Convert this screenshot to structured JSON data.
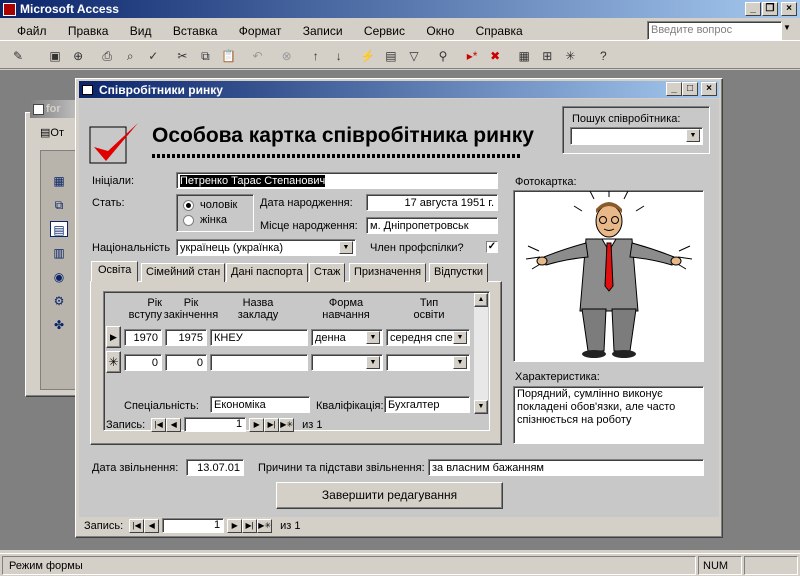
{
  "app": {
    "title": "Microsoft Access"
  },
  "menu": {
    "items": [
      "Файл",
      "Правка",
      "Вид",
      "Вставка",
      "Формат",
      "Записи",
      "Сервис",
      "Окно",
      "Справка"
    ],
    "help_placeholder": "Введите вопрос"
  },
  "bg_window": {
    "title": "for",
    "tab_label": "От"
  },
  "form": {
    "window_title": "Співробітники ринку",
    "heading": "Особова картка співробітника ринку",
    "search": {
      "label": "Пошук співробітника:",
      "value": ""
    },
    "initials": {
      "label": "Ініціали:",
      "value": "Петренко Тарас Степанович"
    },
    "gender": {
      "label": "Стать:",
      "options": [
        "чоловік",
        "жінка"
      ],
      "selected": "чоловік"
    },
    "birth_date": {
      "label": "Дата народження:",
      "value": "17 августа 1951 г."
    },
    "birth_place": {
      "label": "Місце народження:",
      "value": "м. Дніпропетровськ"
    },
    "nationality": {
      "label": "Національність",
      "value": "українець (українка)"
    },
    "union": {
      "label": "Член профспілки?",
      "checked": true
    },
    "photo": {
      "label": "Фотокартка:"
    },
    "characteristic": {
      "label": "Характеристика:",
      "value": "Порядний, сумлінно виконує покладені обов'язки, але часто спізнюється на роботу"
    },
    "tabs": [
      "Освіта",
      "Сімейний стан",
      "Дані паспорта",
      "Стаж",
      "Призначення",
      "Відпустки"
    ],
    "education": {
      "headers": {
        "start": [
          "Рік",
          "вступу"
        ],
        "end": [
          "Рік",
          "закінчення"
        ],
        "school": [
          "Назва",
          "закладу"
        ],
        "form": [
          "Форма",
          "навчання"
        ],
        "type": [
          "Тип",
          "освіти"
        ]
      },
      "rows": [
        {
          "start": "1970",
          "end": "1975",
          "school": "КНЕУ",
          "form": "денна",
          "type": "середня спе"
        },
        {
          "start": "0",
          "end": "0",
          "school": "",
          "form": "",
          "type": ""
        }
      ],
      "specialty": {
        "label": "Спеціальність:",
        "value": "Економіка"
      },
      "qualification": {
        "label": "Кваліфікація:",
        "value": "Бухгалтер"
      },
      "nav": {
        "label": "Запись:",
        "current": "1",
        "of": "из  1"
      }
    },
    "dismissal_date": {
      "label": "Дата звільнення:",
      "value": "13.07.01"
    },
    "dismissal_reason": {
      "label": "Причини та підстави звільнення:",
      "value": "за власним бажанням"
    },
    "finish_button": "Завершити редагування",
    "nav": {
      "label": "Запись:",
      "current": "1",
      "of": "из  1"
    }
  },
  "status": {
    "left": "Режим формы",
    "num": "NUM"
  }
}
